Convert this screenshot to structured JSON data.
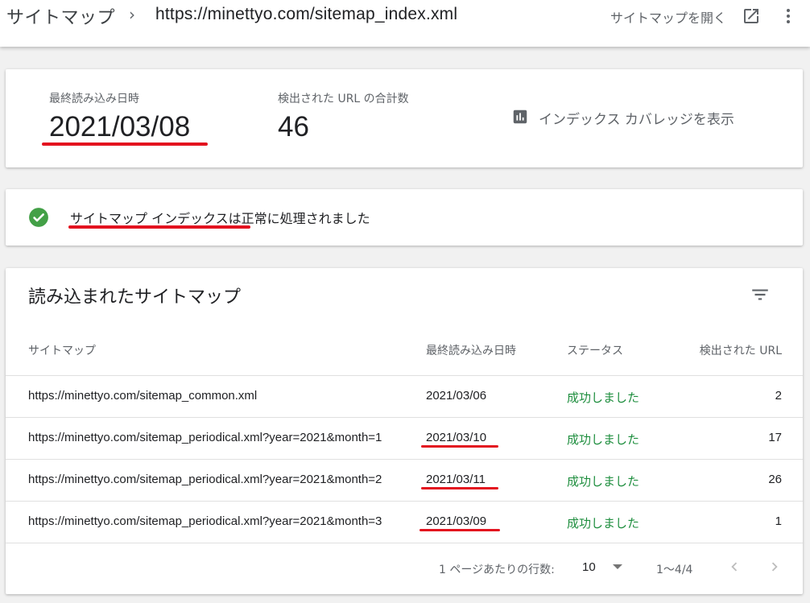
{
  "header": {
    "breadcrumb_root": "サイトマップ",
    "breadcrumb_separator": "›",
    "breadcrumb_current": "https://minettyo.com/sitemap_index.xml",
    "open_sitemap_label": "サイトマップを開く",
    "open_icon": "open-in-new-icon",
    "more_icon": "more-vert-icon"
  },
  "summary": {
    "last_read_label": "最終読み込み日時",
    "last_read_value": "2021/03/08",
    "url_count_label": "検出された URL の合計数",
    "url_count_value": "46",
    "coverage_label": "インデックス カバレッジを表示",
    "coverage_icon": "bar-chart-icon"
  },
  "status": {
    "icon": "check-circle-icon",
    "link_text": "サイトマップ インデックス",
    "message_suffix": "は正常に処理されました"
  },
  "table": {
    "title": "読み込まれたサイトマップ",
    "filter_icon": "filter-list-icon",
    "columns": [
      "サイトマップ",
      "最終読み込み日時",
      "ステータス",
      "検出された URL"
    ],
    "rows": [
      {
        "sitemap": "https://minettyo.com/sitemap_common.xml",
        "date": "2021/03/06",
        "status": "成功しました",
        "count": "2"
      },
      {
        "sitemap": "https://minettyo.com/sitemap_periodical.xml?year=2021&month=1",
        "date": "2021/03/10",
        "status": "成功しました",
        "count": "17"
      },
      {
        "sitemap": "https://minettyo.com/sitemap_periodical.xml?year=2021&month=2",
        "date": "2021/03/11",
        "status": "成功しました",
        "count": "26"
      },
      {
        "sitemap": "https://minettyo.com/sitemap_periodical.xml?year=2021&month=3",
        "date": "2021/03/09",
        "status": "成功しました",
        "count": "1"
      }
    ]
  },
  "pagination": {
    "rows_per_page_label": "1 ページあたりの行数:",
    "rows_per_page_value": "10",
    "range": "1～4/4",
    "prev_icon": "chevron-left-icon",
    "next_icon": "chevron-right-icon"
  },
  "colors": {
    "success": "#1e8e3e",
    "annotation_underline": "#e3121f",
    "check_icon": "#43a047"
  }
}
